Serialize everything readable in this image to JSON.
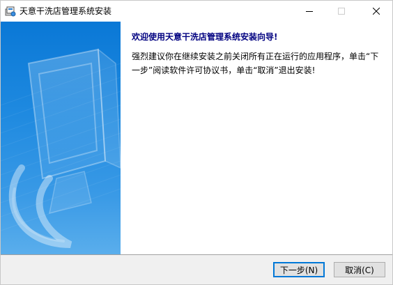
{
  "window": {
    "title": "天意干洗店管理系统安装",
    "icon": "installer-icon",
    "controls": {
      "minimize_icon": "minimize-icon",
      "maximize_icon": "maximize-icon",
      "close_icon": "close-icon"
    }
  },
  "content": {
    "heading": "欢迎使用天意干洗店管理系统安装向导!",
    "description": "强烈建议你在继续安装之前关闭所有正在运行的应用程序，单击“下一步”阅读软件许可协议书，单击“取消”退出安装!"
  },
  "buttons": {
    "next_label": "下一步(N)",
    "cancel_label": "取消(C)"
  },
  "colors": {
    "banner": "#1f8ae0",
    "heading": "#000080",
    "default_button_border": "#0078d7"
  }
}
